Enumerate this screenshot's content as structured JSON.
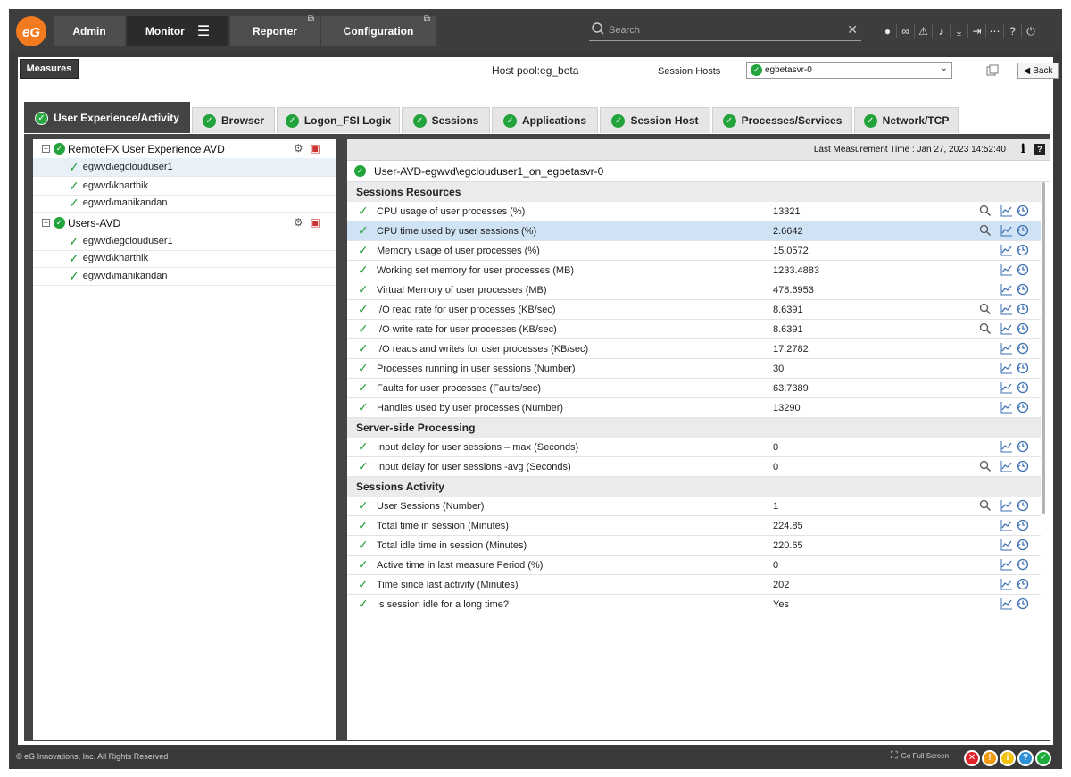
{
  "topbar": {
    "tabs": [
      {
        "label": "Admin"
      },
      {
        "label": "Monitor"
      },
      {
        "label": "Reporter"
      },
      {
        "label": "Configuration"
      }
    ],
    "search_placeholder": "Search"
  },
  "toolbar": {
    "measures_label": "Measures",
    "host_pool": "Host pool:eg_beta",
    "session_hosts_label": "Session Hosts",
    "selected_host": "egbetasvr-0",
    "back_label": "Back"
  },
  "tabs": [
    {
      "label": "User Experience/Activity",
      "active": true
    },
    {
      "label": "Browser"
    },
    {
      "label": "Logon_FSI Logix"
    },
    {
      "label": "Sessions"
    },
    {
      "label": "Applications"
    },
    {
      "label": "Session Host"
    },
    {
      "label": "Processes/Services"
    },
    {
      "label": "Network/TCP"
    }
  ],
  "tree": {
    "groups": [
      {
        "label": "RemoteFX User Experience AVD",
        "items": [
          "egwvd\\egclouduser1",
          "egwvd\\kharthik",
          "egwvd\\manikandan"
        ]
      },
      {
        "label": "Users-AVD",
        "items": [
          "egwvd\\egclouduser1",
          "egwvd\\kharthik",
          "egwvd\\manikandan"
        ]
      }
    ]
  },
  "detail": {
    "last_measurement": "Last Measurement Time : Jan 27, 2023 14:52:40",
    "component": "User-AVD-egwvd\\egclouduser1_on_egbetasvr-0",
    "sections": [
      {
        "title": "Sessions Resources",
        "rows": [
          {
            "name": "CPU usage of user processes (%)",
            "value": "13321",
            "search": true
          },
          {
            "name": "CPU time used by user sessions (%)",
            "value": "2.6642",
            "search": true,
            "highlight": true
          },
          {
            "name": "Memory usage of user processes (%)",
            "value": "15.0572"
          },
          {
            "name": "Working set memory for user processes (MB)",
            "value": "1233.4883"
          },
          {
            "name": "Virtual Memory of user processes (MB)",
            "value": "478.6953"
          },
          {
            "name": "I/O read rate for user processes (KB/sec)",
            "value": "8.6391",
            "search": true
          },
          {
            "name": "I/O write rate for user processes (KB/sec)",
            "value": "8.6391",
            "search": true
          },
          {
            "name": "I/O reads and writes for user processes (KB/sec)",
            "value": "17.2782"
          },
          {
            "name": "Processes running in user sessions (Number)",
            "value": "30"
          },
          {
            "name": "Faults for user processes (Faults/sec)",
            "value": "63.7389"
          },
          {
            "name": "Handles used by user processes (Number)",
            "value": "13290"
          }
        ]
      },
      {
        "title": "Server-side Processing",
        "rows": [
          {
            "name": "Input delay for user sessions – max (Seconds)",
            "value": "0"
          },
          {
            "name": "Input delay for user sessions -avg (Seconds)",
            "value": "0",
            "search": true
          }
        ]
      },
      {
        "title": "Sessions Activity",
        "rows": [
          {
            "name": "User Sessions (Number)",
            "value": "1",
            "search": true
          },
          {
            "name": "Total time in session (Minutes)",
            "value": "224.85"
          },
          {
            "name": "Total idle time in session (Minutes)",
            "value": "220.65"
          },
          {
            "name": "Active time in last measure Period (%)",
            "value": "0"
          },
          {
            "name": "Time since last activity (Minutes)",
            "value": "202"
          },
          {
            "name": "Is session idle for a long time?",
            "value": "Yes"
          }
        ]
      }
    ]
  },
  "footer": {
    "copyright": "© eG Innovations, Inc. All Rights Reserved",
    "fullscreen": "Go Full Screen",
    "status_colors": [
      "#e0242c",
      "#f29b12",
      "#f2c20f",
      "#2d8fd5",
      "#1faa3c"
    ]
  }
}
